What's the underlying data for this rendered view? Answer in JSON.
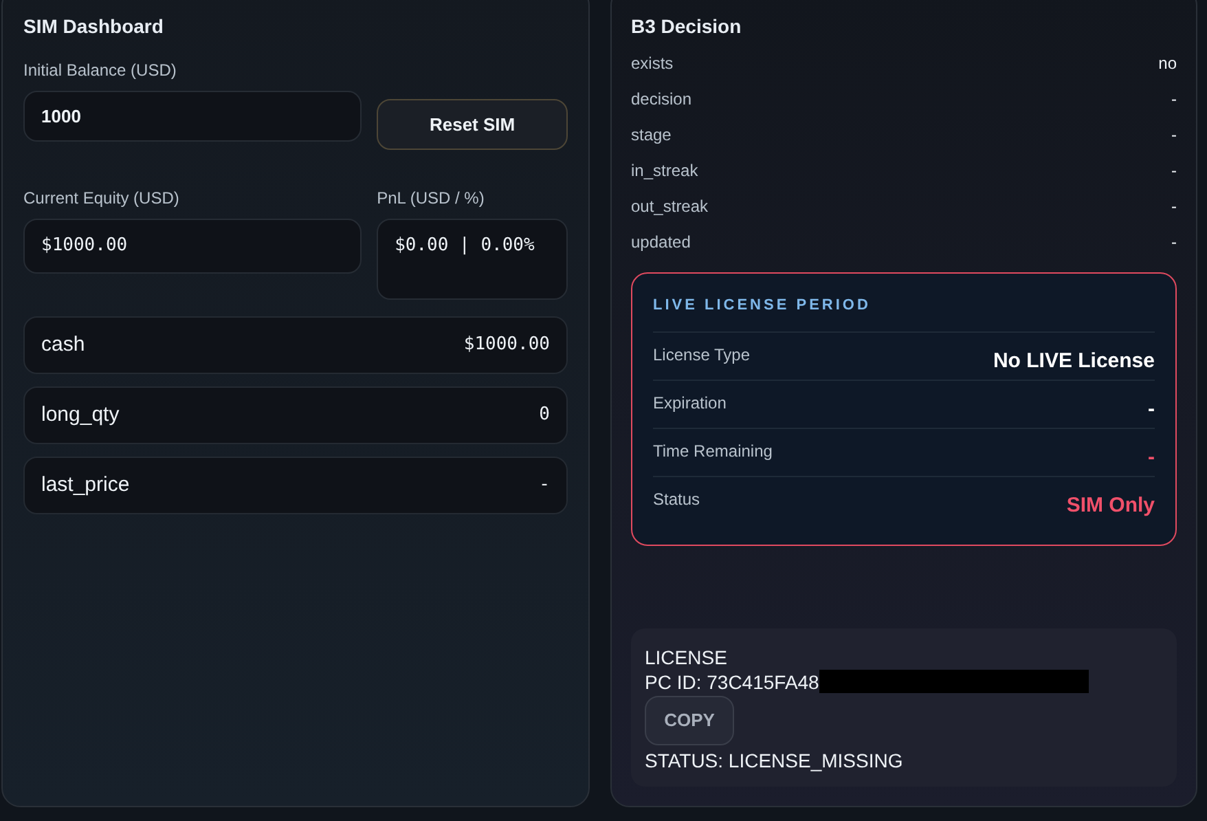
{
  "sim_dashboard": {
    "title": "SIM Dashboard",
    "initial_balance": {
      "label": "Initial Balance (USD)",
      "value": "1000"
    },
    "reset_button": "Reset SIM",
    "current_equity": {
      "label": "Current Equity (USD)",
      "value": "$1000.00"
    },
    "pnl": {
      "label": "PnL (USD / %)",
      "value": "$0.00 | 0.00%"
    },
    "stats": [
      {
        "name": "cash",
        "value": "$1000.00"
      },
      {
        "name": "long_qty",
        "value": "0"
      },
      {
        "name": "last_price",
        "value": "-"
      }
    ]
  },
  "b3_decision": {
    "title": "B3 Decision",
    "rows": [
      {
        "name": "exists",
        "value": "no"
      },
      {
        "name": "decision",
        "value": "-"
      },
      {
        "name": "stage",
        "value": "-"
      },
      {
        "name": "in_streak",
        "value": "-"
      },
      {
        "name": "out_streak",
        "value": "-"
      },
      {
        "name": "updated",
        "value": "-"
      }
    ],
    "license_period": {
      "title": "LIVE LICENSE PERIOD",
      "rows": [
        {
          "label": "License Type",
          "value": "No LIVE License",
          "color": "#ffffff"
        },
        {
          "label": "Expiration",
          "value": "-",
          "color": "#ffffff"
        },
        {
          "label": "Time Remaining",
          "value": "-",
          "color": "#f0506a"
        },
        {
          "label": "Status",
          "value": "SIM Only",
          "color": "#f0506a"
        }
      ]
    },
    "license": {
      "title": "LICENSE",
      "pc_id": "PC ID: 73C415FA48",
      "copy_button": "COPY",
      "status": "STATUS: LICENSE_MISSING"
    }
  }
}
